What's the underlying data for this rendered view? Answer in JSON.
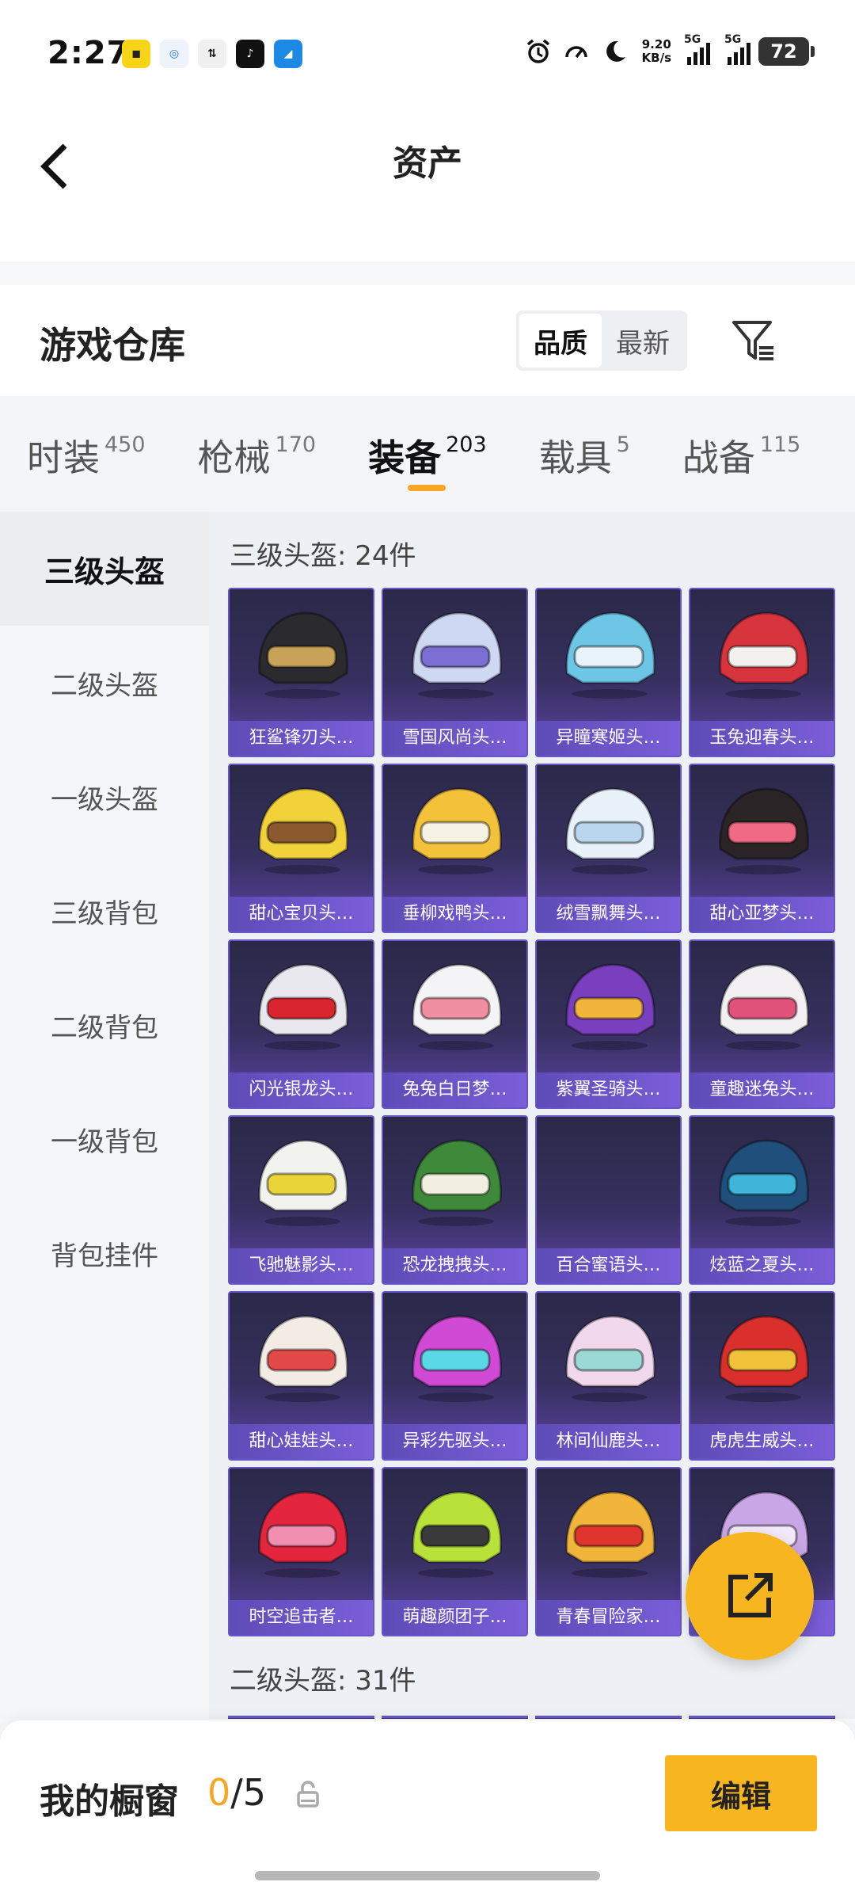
{
  "status_bar": {
    "time": "2:27",
    "app_icons": [
      "note-app-icon",
      "mobile-network-icon",
      "share-app-icon",
      "tiktok-icon",
      "browser-icon"
    ],
    "net_speed_value": "9.20",
    "net_speed_unit": "KB/s",
    "signal_1_label": "5G",
    "signal_2_label": "5G",
    "battery": "72"
  },
  "header": {
    "title": "资产",
    "back_icon": "chevron-left-icon"
  },
  "warehouse": {
    "title": "游戏仓库",
    "sort_options": [
      {
        "label": "品质",
        "active": true
      },
      {
        "label": "最新",
        "active": false
      }
    ],
    "filter_icon": "filter-icon"
  },
  "tabs": [
    {
      "label": "时装",
      "count": "450",
      "active": false
    },
    {
      "label": "枪械",
      "count": "170",
      "active": false
    },
    {
      "label": "装备",
      "count": "203",
      "active": true
    },
    {
      "label": "载具",
      "count": "5",
      "active": false
    },
    {
      "label": "战备",
      "count": "115",
      "active": false
    }
  ],
  "sidebar": {
    "items": [
      {
        "label": "三级头盔",
        "active": true
      },
      {
        "label": "二级头盔",
        "active": false
      },
      {
        "label": "一级头盔",
        "active": false
      },
      {
        "label": "三级背包",
        "active": false
      },
      {
        "label": "二级背包",
        "active": false
      },
      {
        "label": "一级背包",
        "active": false
      },
      {
        "label": "背包挂件",
        "active": false
      }
    ]
  },
  "content": {
    "section1_title": "三级头盔: 24件",
    "section2_title": "二级头盔: 31件",
    "items": [
      {
        "label": "狂鲨锋刃头…",
        "color": "#2b2b2f",
        "accent": "#c9a25a"
      },
      {
        "label": "雪国风尚头…",
        "color": "#cfd8f2",
        "accent": "#7c6fd3"
      },
      {
        "label": "异瞳寒姬头…",
        "color": "#6ec6e6",
        "accent": "#e9f3fb"
      },
      {
        "label": "玉兔迎春头…",
        "color": "#d8343d",
        "accent": "#f3f1ee"
      },
      {
        "label": "甜心宝贝头…",
        "color": "#f2d23b",
        "accent": "#8a5a2e"
      },
      {
        "label": "垂柳戏鸭头…",
        "color": "#f4c23a",
        "accent": "#f6f2e4"
      },
      {
        "label": "绒雪飘舞头…",
        "color": "#e9f2fb",
        "accent": "#b9d6ee"
      },
      {
        "label": "甜心亚梦头…",
        "color": "#2a2426",
        "accent": "#f06a86"
      },
      {
        "label": "闪光银龙头…",
        "color": "#e8e8ee",
        "accent": "#d9262e"
      },
      {
        "label": "兔兔白日梦…",
        "color": "#f4f4f6",
        "accent": "#f08fa2"
      },
      {
        "label": "紫翼圣骑头…",
        "color": "#7a3fbe",
        "accent": "#f0b53a"
      },
      {
        "label": "童趣迷兔头…",
        "color": "#f2f0f2",
        "accent": "#e0527a"
      },
      {
        "label": "飞驰魅影头…",
        "color": "#f2f2ee",
        "accent": "#e9d53a"
      },
      {
        "label": "恐龙拽拽头…",
        "color": "#3e8a3a",
        "accent": "#f3efe0"
      },
      {
        "label": "百合蜜语头…",
        "color": "",
        "accent": ""
      },
      {
        "label": "炫蓝之夏头…",
        "color": "#1f4f7a",
        "accent": "#3fb5d9"
      },
      {
        "label": "甜心娃娃头…",
        "color": "#f2ece4",
        "accent": "#e24a4a"
      },
      {
        "label": "异彩先驱头…",
        "color": "#d04ad6",
        "accent": "#5ad8e6"
      },
      {
        "label": "林间仙鹿头…",
        "color": "#f2d8ec",
        "accent": "#9ad9d6"
      },
      {
        "label": "虎虎生威头…",
        "color": "#d9302e",
        "accent": "#f0c23a"
      },
      {
        "label": "时空追击者…",
        "color": "#e3263e",
        "accent": "#f08fb0"
      },
      {
        "label": "萌趣颜团子…",
        "color": "#b8e23a",
        "accent": "#3a3a3a"
      },
      {
        "label": "青春冒险家…",
        "color": "#f0b53a",
        "accent": "#e0342e"
      },
      {
        "label": "",
        "color": "#c9a6e6",
        "accent": "#f3e9fb"
      }
    ]
  },
  "fab": {
    "icon": "share-external-icon"
  },
  "showcase": {
    "title": "我的橱窗",
    "count_current": "0",
    "count_total": "/5",
    "lock_icon": "lock-icon",
    "edit_label": "编辑"
  }
}
